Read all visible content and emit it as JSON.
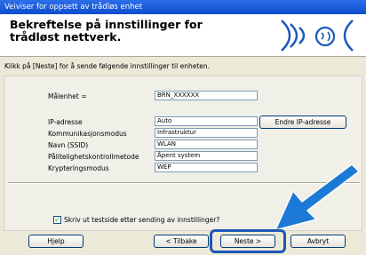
{
  "window": {
    "title": "Veiviser for oppsett av trådløs enhet"
  },
  "banner": {
    "title": "Bekreftelse på innstillinger for trådløst nettverk."
  },
  "instructions": "Klikk på [Neste] for å sende følgende innstillinger til enheten.",
  "target_device": {
    "label": "Målenhet =",
    "value": "BRN_XXXXXX"
  },
  "settings": [
    {
      "label": "IP-adresse",
      "value": "Auto"
    },
    {
      "label": "Kommunikasjonsmodus",
      "value": "Infrastruktur"
    },
    {
      "label": "Navn (SSID)",
      "value": "WLAN"
    },
    {
      "label": "Pålitelighetskontrollmetode",
      "value": "Åpent system"
    },
    {
      "label": "Krypteringsmodus",
      "value": "WEP"
    }
  ],
  "change_ip_button": "Endre IP-adresse",
  "print_checkbox": {
    "label": "Skriv ut testside etter sending av innstillinger?",
    "checked": true
  },
  "buttons": {
    "help": "Hjelp",
    "back": "< Tilbake",
    "next": "Neste >",
    "cancel": "Avbryt"
  },
  "colors": {
    "accent": "#1c57b8",
    "titlebar": "#0d4ed0",
    "arrow": "#1c7ad6"
  }
}
